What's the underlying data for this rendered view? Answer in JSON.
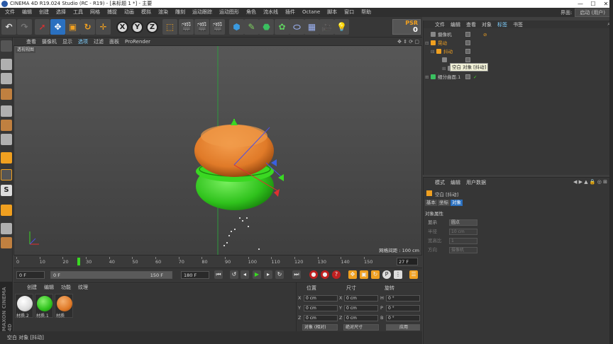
{
  "title_bar": {
    "title": "CINEMA 4D R19.024 Studio (RC - R19) - [未标题 1 *] - 主要",
    "min": "—",
    "max": "☐",
    "close": "✕"
  },
  "menu": {
    "items": [
      "文件",
      "编辑",
      "创建",
      "选择",
      "工具",
      "网格",
      "捕捉",
      "动画",
      "模拟",
      "渲染",
      "雕刻",
      "运动跟踪",
      "运动图形",
      "角色",
      "流水线",
      "插件",
      "Octane",
      "脚本",
      "窗口",
      "帮助"
    ],
    "layout_label": "界面:",
    "layout_value": "启动 (用户)"
  },
  "toolbar": {
    "axis_x": "X",
    "axis_y": "Y",
    "axis_z": "Z",
    "psr_label": "PSR",
    "psr_value": "0"
  },
  "viewport": {
    "menu": [
      "查看",
      "摄像机",
      "显示",
      "选项",
      "过滤",
      "面板",
      "ProRender"
    ],
    "active_menu": "选项",
    "label": "透视视图",
    "grid_spacing": "网格间距 : 100 cm"
  },
  "timeline": {
    "ticks": [
      "0",
      "10",
      "20",
      "30",
      "40",
      "50",
      "60",
      "70",
      "80",
      "90",
      "100",
      "110",
      "120",
      "130",
      "140",
      "150"
    ],
    "current_frame": "27 F",
    "playhead_frame": 27
  },
  "transport": {
    "start_field": "0 F",
    "range_start": "0 F",
    "range_end": "150 F",
    "end_field": "180 F"
  },
  "materials": {
    "menu": [
      "创建",
      "编辑",
      "功能",
      "纹理"
    ],
    "items": [
      {
        "label": "材质.2",
        "color": "#ffffff"
      },
      {
        "label": "材质.1",
        "color": "#2fc21c"
      },
      {
        "label": "材质",
        "color": "#e07a28"
      }
    ]
  },
  "coordinates": {
    "headers": [
      "位置",
      "尺寸",
      "旋转"
    ],
    "rows": [
      {
        "axis": "X",
        "pos": "0 cm",
        "size_axis": "X",
        "size": "0 cm",
        "rot_axis": "H",
        "rot": "0 °"
      },
      {
        "axis": "Y",
        "pos": "0 cm",
        "size_axis": "Y",
        "size": "0 cm",
        "rot_axis": "P",
        "rot": "0 °"
      },
      {
        "axis": "Z",
        "pos": "0 cm",
        "size_axis": "Z",
        "size": "0 cm",
        "rot_axis": "B",
        "rot": "0 °"
      }
    ],
    "mode_select": "对象 (相对)",
    "size_select": "绝对尺寸",
    "apply": "应用"
  },
  "object_manager": {
    "menu": [
      "文件",
      "编辑",
      "查看",
      "对象",
      "标签",
      "书签"
    ],
    "active_menu": "标签",
    "objects": [
      {
        "name": "摄像机",
        "color": "#c8c8c8"
      },
      {
        "name": "晃动",
        "color": "#f0a020"
      },
      {
        "name": "抖动",
        "color": "#f0a020"
      },
      {
        "name": "",
        "color": "#c8c8c8"
      },
      {
        "name": "",
        "color": "#c8c8c8"
      },
      {
        "name": "细分曲面.1",
        "color": "#c8c8c8"
      }
    ],
    "tooltip": "空白 对象 [抖动]"
  },
  "attributes": {
    "menu": [
      "模式",
      "编辑",
      "用户数据"
    ],
    "object_title": "空白 [抖动]",
    "tabs": [
      "基本",
      "坐标",
      "对象"
    ],
    "active_tab": "对象",
    "section": "对象属性",
    "fields": [
      {
        "label": "显示",
        "value": "圆点",
        "dim": false
      },
      {
        "label": "半径",
        "value": "10 cm",
        "dim": true
      },
      {
        "label": "宽高比",
        "value": "1",
        "dim": true
      },
      {
        "label": "方向",
        "value": "摄像机",
        "dim": true
      }
    ]
  },
  "status_bar": {
    "text": "空白 对象 [抖动]"
  },
  "brand": "MAXON CINEMA 4D",
  "colors": {
    "top_disc": "#e07a28",
    "bottom_disc": "#2fc21c",
    "active_blue": "#2a70c0"
  }
}
